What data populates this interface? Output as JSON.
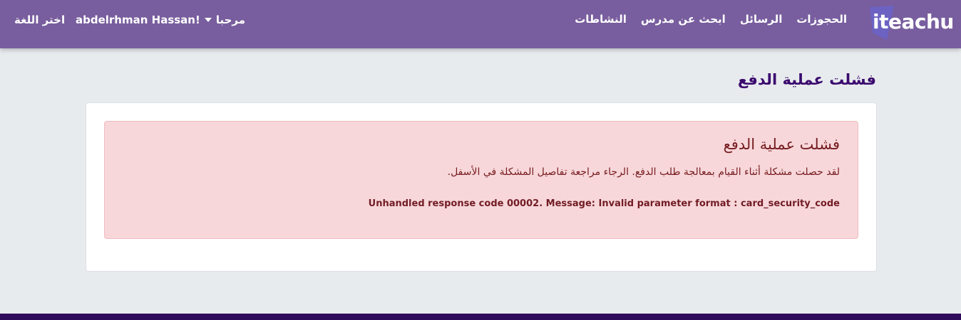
{
  "nav": {
    "logo_text": "iteachu",
    "links": [
      "النشاطات",
      "ابحث عن مدرس",
      "الرسائل",
      "الحجوزات"
    ],
    "greeting": "مرحبا",
    "user_name": "abdelrhman Hassan!",
    "language_label": "اختر اللغة"
  },
  "main": {
    "page_title": "فشلت عملية الدفع",
    "alert": {
      "heading": "فشلت عملية الدفع",
      "message": "لقد حصلت مشكلة أثناء القيام بمعالجة طلب الدفع. الرجاء مراجعة تفاصيل المشكلة في الأسفل.",
      "detail": "Unhandled response code 00002. Message: Invalid parameter format : card_security_code"
    }
  },
  "colors": {
    "navbar": "#785e9e",
    "title": "#3a0a6e",
    "alert_bg": "#f7d7da",
    "alert_text": "#761b1f",
    "footer": "#2e0a5a"
  }
}
